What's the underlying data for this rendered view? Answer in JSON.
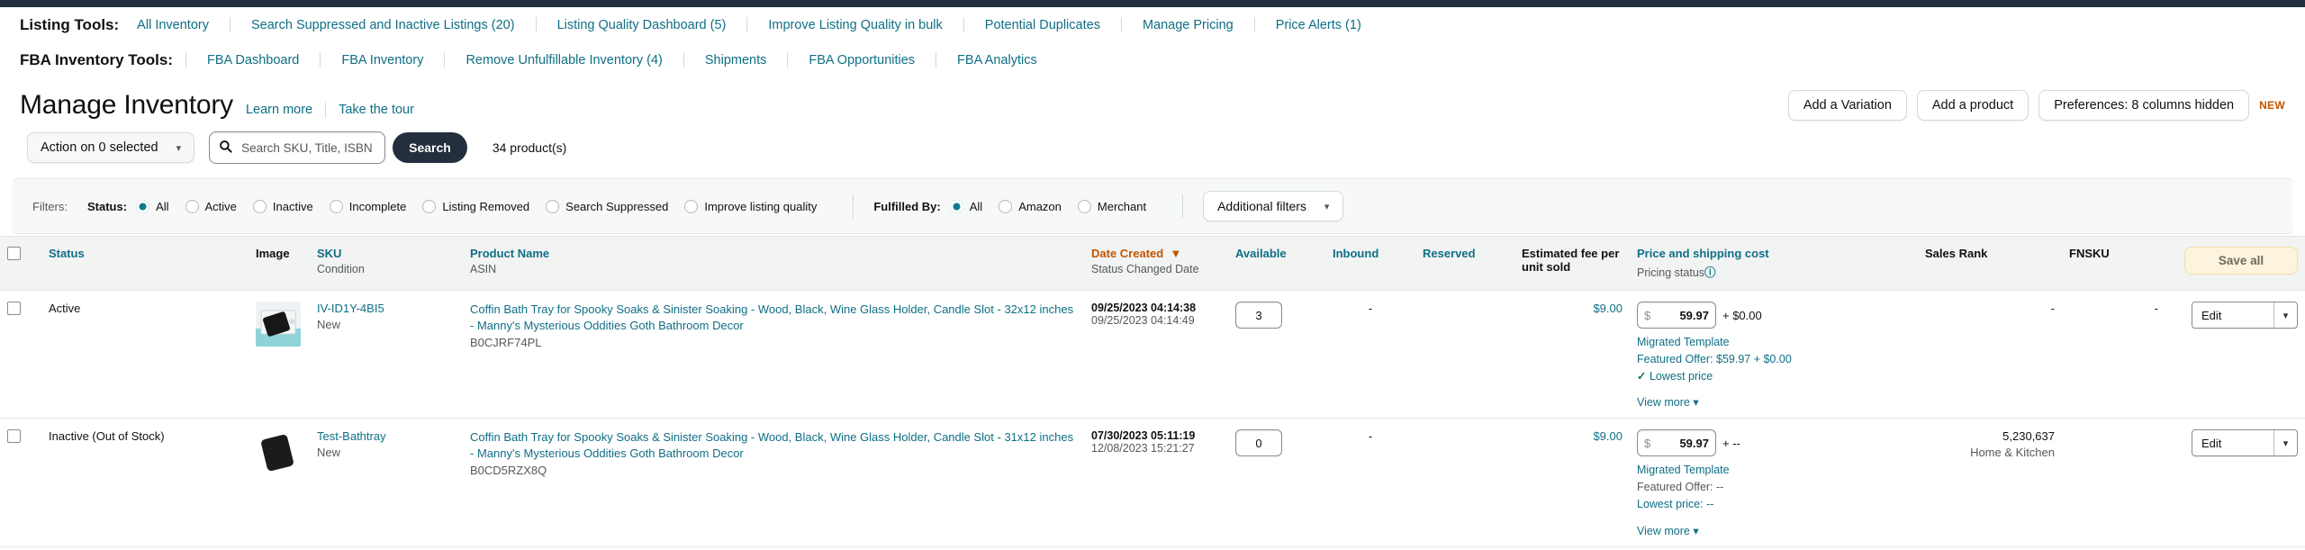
{
  "colors": {
    "accent": "#0f6f85",
    "brand_dark": "#232f3e",
    "sorted": "#c45500",
    "teal_radio": "#0f7b8f"
  },
  "listing_tools": {
    "label": "Listing Tools:",
    "items": [
      "All Inventory",
      "Search Suppressed and Inactive Listings (20)",
      "Listing Quality Dashboard (5)",
      "Improve Listing Quality in bulk",
      "Potential Duplicates",
      "Manage Pricing",
      "Price Alerts (1)"
    ]
  },
  "fba_tools": {
    "label": "FBA Inventory Tools:",
    "items": [
      "FBA Dashboard",
      "FBA Inventory",
      "Remove Unfulfillable Inventory (4)",
      "Shipments",
      "FBA Opportunities",
      "FBA Analytics"
    ]
  },
  "header": {
    "title": "Manage Inventory",
    "learn_more": "Learn more",
    "take_tour": "Take the tour",
    "add_variation": "Add a Variation",
    "add_product": "Add a product",
    "preferences": "Preferences: 8 columns hidden",
    "new_badge": "NEW"
  },
  "actionbar": {
    "action_select": "Action on 0 selected",
    "search_placeholder": "Search SKU, Title, ISBN",
    "search_value": "",
    "search_button": "Search",
    "product_count": "34 product(s)",
    "search_icon": "search-icon"
  },
  "filters": {
    "label": "Filters:",
    "status_label": "Status:",
    "status_options": [
      {
        "label": "All",
        "selected": true
      },
      {
        "label": "Active",
        "selected": false
      },
      {
        "label": "Inactive",
        "selected": false
      },
      {
        "label": "Incomplete",
        "selected": false
      },
      {
        "label": "Listing Removed",
        "selected": false
      },
      {
        "label": "Search Suppressed",
        "selected": false
      },
      {
        "label": "Improve listing quality",
        "selected": false
      }
    ],
    "fulfilled_label": "Fulfilled By:",
    "fulfilled_options": [
      {
        "label": "All",
        "selected": true
      },
      {
        "label": "Amazon",
        "selected": false
      },
      {
        "label": "Merchant",
        "selected": false
      }
    ],
    "additional_filters": "Additional filters"
  },
  "table": {
    "columns": {
      "status": "Status",
      "image": "Image",
      "sku": "SKU",
      "condition": "Condition",
      "product_name": "Product Name",
      "asin": "ASIN",
      "date_created": "Date Created",
      "status_changed": "Status Changed Date",
      "available": "Available",
      "inbound": "Inbound",
      "reserved": "Reserved",
      "estimated_fee": "Estimated fee per unit sold",
      "price_shipping": "Price and shipping cost",
      "pricing_status": "Pricing status",
      "sales_rank": "Sales Rank",
      "fnsku": "FNSKU",
      "save_all": "Save all"
    },
    "rows": [
      {
        "status": "Active",
        "sku": "IV-ID1Y-4BI5",
        "condition": "New",
        "product_name": "Coffin Bath Tray for Spooky Soaks & Sinister Soaking - Wood, Black, Wine Glass Holder, Candle Slot - 32x12 inches - Manny's Mysterious Oddities Goth Bathroom Decor",
        "asin": "B0CJRF74PL",
        "date_created": "09/25/2023 04:14:38",
        "status_changed": "09/25/2023 04:14:49",
        "available": "3",
        "inbound": "-",
        "reserved": "",
        "estimated_fee": "$9.00",
        "price_currency": "$",
        "price_value": "59.97",
        "shipping": "+ $0.00",
        "pricing_template": "Migrated Template",
        "featured_offer": "Featured Offer: $59.97 + $0.00",
        "lowest_price": "Lowest price",
        "lowest_price_check": true,
        "view_more": "View more",
        "sales_rank": "-",
        "sales_category": "",
        "fnsku": "-",
        "edit_label": "Edit"
      },
      {
        "status": "Inactive (Out of Stock)",
        "sku": "Test-Bathtray",
        "condition": "New",
        "product_name": "Coffin Bath Tray for Spooky Soaks & Sinister Soaking - Wood, Black, Wine Glass Holder, Candle Slot - 31x12 inches - Manny's Mysterious Oddities Goth Bathroom Decor",
        "asin": "B0CD5RZX8Q",
        "date_created": "07/30/2023 05:11:19",
        "status_changed": "12/08/2023 15:21:27",
        "available": "0",
        "inbound": "-",
        "reserved": "",
        "estimated_fee": "$9.00",
        "price_currency": "$",
        "price_value": "59.97",
        "shipping": "+ --",
        "pricing_template": "Migrated Template",
        "featured_offer": "Featured Offer: --",
        "lowest_price": "Lowest price: --",
        "lowest_price_check": false,
        "view_more": "View more",
        "sales_rank": "5,230,637",
        "sales_category": "Home & Kitchen",
        "fnsku": "",
        "edit_label": "Edit"
      }
    ]
  }
}
